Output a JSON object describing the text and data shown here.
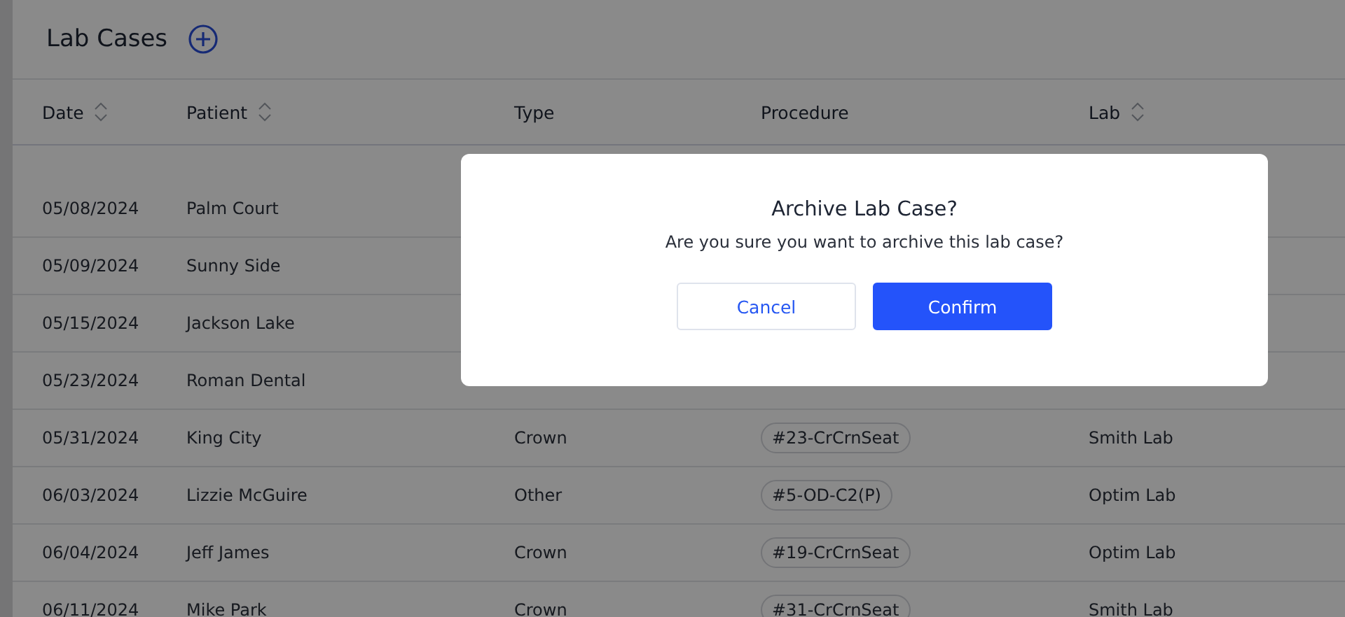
{
  "page": {
    "title": "Lab Cases"
  },
  "table": {
    "columns": [
      {
        "label": "Date",
        "sortable": true
      },
      {
        "label": "Patient",
        "sortable": true
      },
      {
        "label": "Type",
        "sortable": false
      },
      {
        "label": "Procedure",
        "sortable": false
      },
      {
        "label": "Lab",
        "sortable": true
      }
    ],
    "rows": [
      {
        "date": "05/08/2024",
        "patient": "Palm Court"
      },
      {
        "date": "05/09/2024",
        "patient": "Sunny Side"
      },
      {
        "date": "05/15/2024",
        "patient": "Jackson Lake"
      },
      {
        "date": "05/23/2024",
        "patient": "Roman Dental"
      },
      {
        "date": "05/31/2024",
        "patient": "King City",
        "type": "Crown",
        "procedure": "#23-CrCrnSeat",
        "lab": "Smith Lab"
      },
      {
        "date": "06/03/2024",
        "patient": "Lizzie McGuire",
        "type": "Other",
        "procedure": "#5-OD-C2(P)",
        "lab": "Optim Lab"
      },
      {
        "date": "06/04/2024",
        "patient": "Jeff James",
        "type": "Crown",
        "procedure": "#19-CrCrnSeat",
        "lab": "Optim Lab"
      },
      {
        "date": "06/11/2024",
        "patient": "Mike Park",
        "type": "Crown",
        "procedure": "#31-CrCrnSeat",
        "lab": "Smith Lab"
      }
    ]
  },
  "dialog": {
    "title": "Archive Lab Case?",
    "message": "Are you sure you want to archive this lab case?",
    "buttons": [
      {
        "label": "Cancel",
        "kind": "secondary"
      },
      {
        "label": "Confirm",
        "kind": "primary"
      }
    ]
  }
}
